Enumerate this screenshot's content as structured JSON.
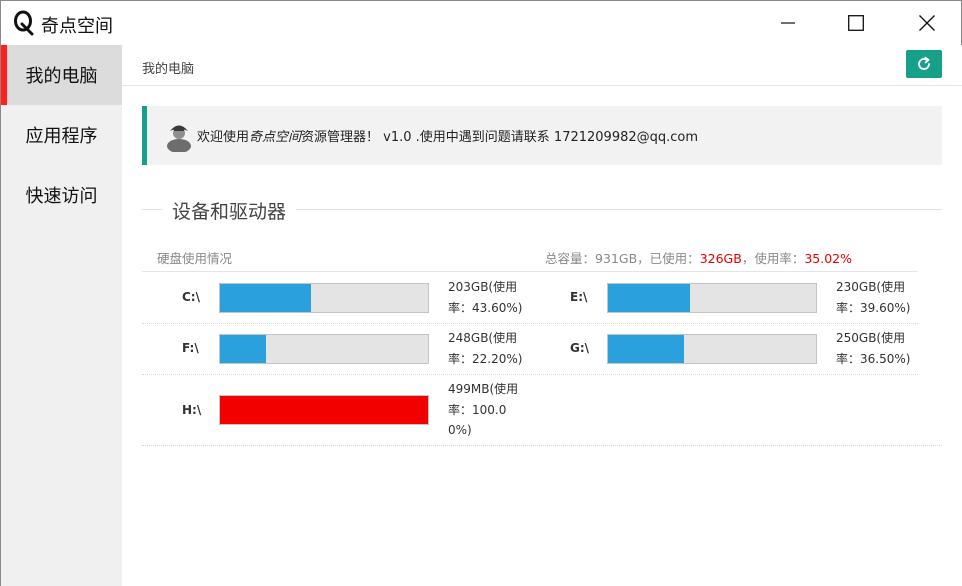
{
  "app": {
    "title": "奇点空间"
  },
  "window_controls": {
    "minimize_icon": "minimize-icon",
    "maximize_icon": "maximize-icon",
    "close_icon": "close-icon"
  },
  "sidebar": {
    "items": [
      {
        "label": "我的电脑",
        "active": true
      },
      {
        "label": "应用程序",
        "active": false
      },
      {
        "label": "快速访问",
        "active": false
      }
    ]
  },
  "header": {
    "breadcrumb": "我的电脑",
    "refresh_icon": "refresh-icon"
  },
  "notice": {
    "prefix": "欢迎使用",
    "brand": "奇点空间",
    "suffix": "资源管理器！ v1.0 .使用中遇到问题请联系 1721209982@qq.com"
  },
  "section": {
    "title": "设备和驱动器"
  },
  "summary": {
    "label": "硬盘使用情况",
    "total_label": "总容量：",
    "total": "931GB",
    "used_label": "，已使用：",
    "used": "326GB",
    "rate_label": "，使用率：",
    "rate": "35.02%"
  },
  "drives": [
    {
      "letter": "C:\\",
      "usage_text": "203GB(使用率：43.60%)",
      "percent": 43.6
    },
    {
      "letter": "E:\\",
      "usage_text": "230GB(使用率：39.60%)",
      "percent": 39.6
    },
    {
      "letter": "F:\\",
      "usage_text": "248GB(使用率：22.20%)",
      "percent": 22.2
    },
    {
      "letter": "G:\\",
      "usage_text": "250GB(使用率：36.50%)",
      "percent": 36.5
    },
    {
      "letter": "H:\\",
      "usage_text": "499MB(使用率：100.00%)",
      "percent": 100.0
    }
  ],
  "colors": {
    "accent": "#16a08a",
    "active_marker": "#ff1f1f",
    "bar_fill": "#2aa0dc",
    "bar_full": "#f20000",
    "highlight_text": "#e80000"
  }
}
